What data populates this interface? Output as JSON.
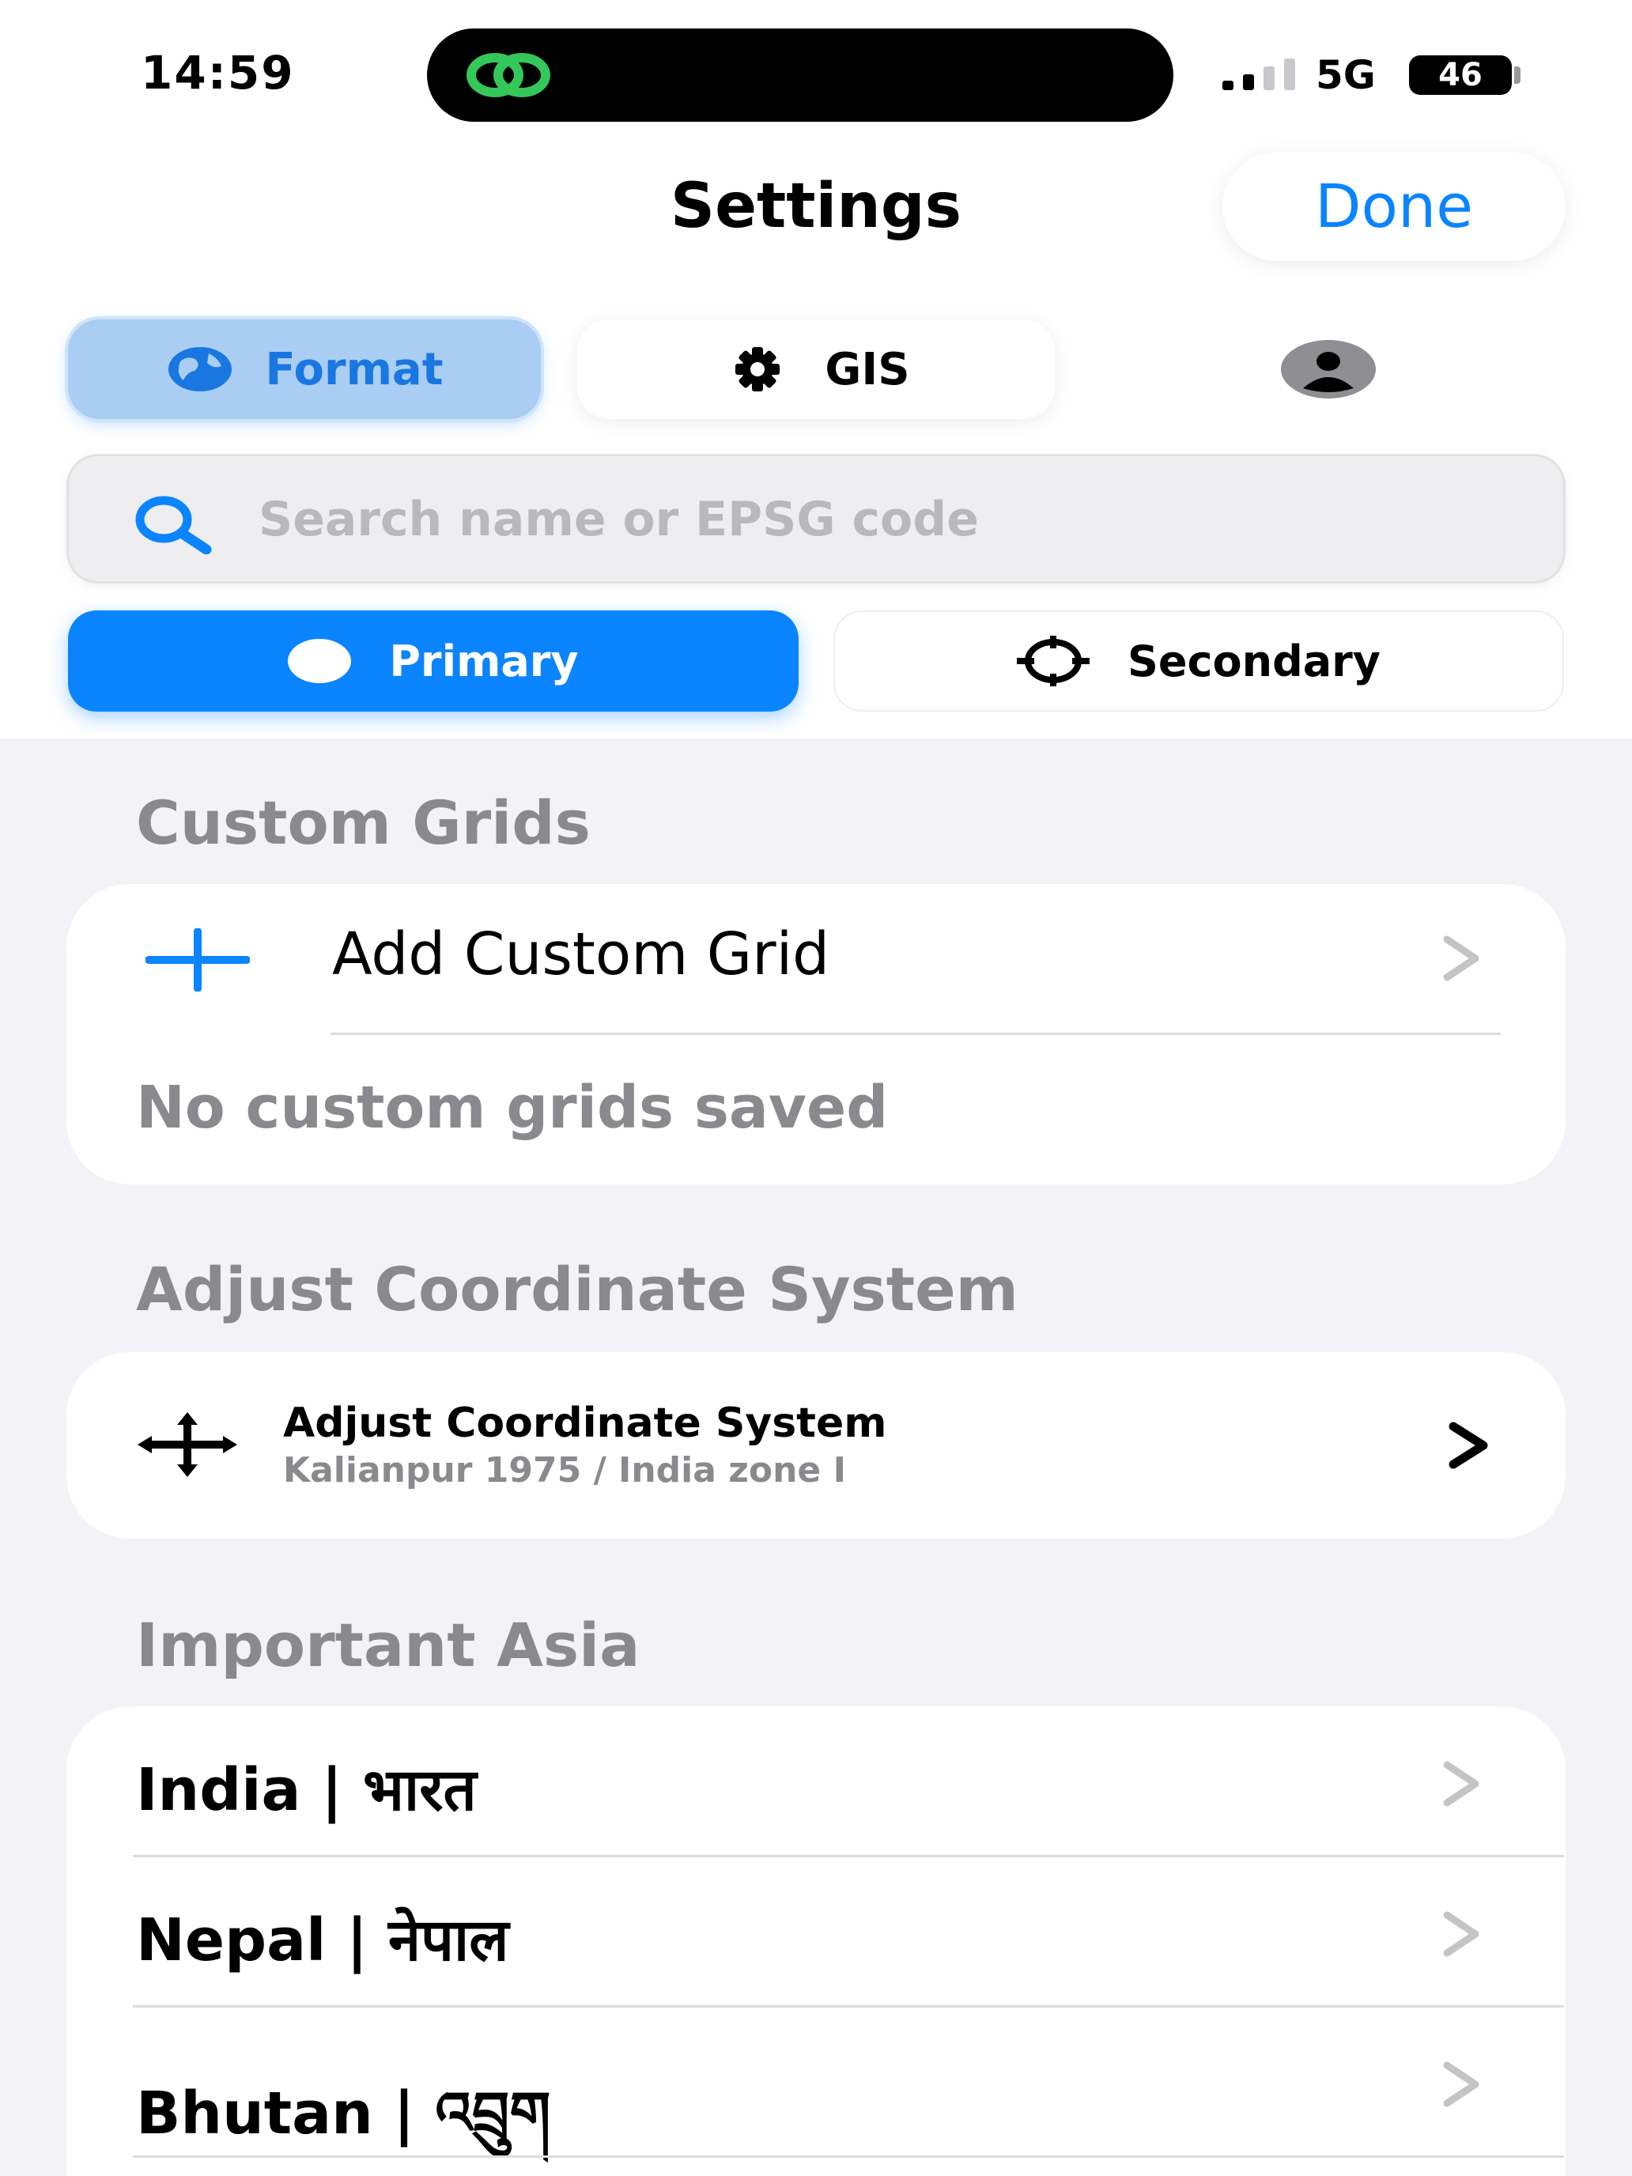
{
  "status": {
    "time": "14:59",
    "network": "5G",
    "battery": "46"
  },
  "nav": {
    "title": "Settings",
    "done_label": "Done"
  },
  "tabs": [
    {
      "label": "Format",
      "icon": "globe-icon",
      "selected": true
    },
    {
      "label": "GIS",
      "icon": "gear-icon",
      "selected": false
    },
    {
      "label": "",
      "icon": "person-icon",
      "selected": false
    }
  ],
  "search": {
    "placeholder": "Search name or EPSG code",
    "value": ""
  },
  "segments": [
    {
      "label": "Primary",
      "icon": "dot-icon",
      "selected": true
    },
    {
      "label": "Secondary",
      "icon": "crosshair-icon",
      "selected": false
    }
  ],
  "custom_grids": {
    "header": "Custom Grids",
    "add_label": "Add Custom Grid",
    "empty_text": "No custom grids saved"
  },
  "adjust": {
    "header": "Adjust Coordinate System",
    "title": "Adjust Coordinate System",
    "subtitle": "Kalianpur 1975 / India zone I"
  },
  "important_asia": {
    "header": "Important Asia",
    "countries": [
      {
        "label": "India | भारत"
      },
      {
        "label": "Nepal | नेपाल"
      },
      {
        "label": "Bhutan | འབྲུག"
      }
    ]
  },
  "colors": {
    "accent": "#0a84ff",
    "background": "#f2f2f7",
    "muted": "#8a8a8e"
  }
}
